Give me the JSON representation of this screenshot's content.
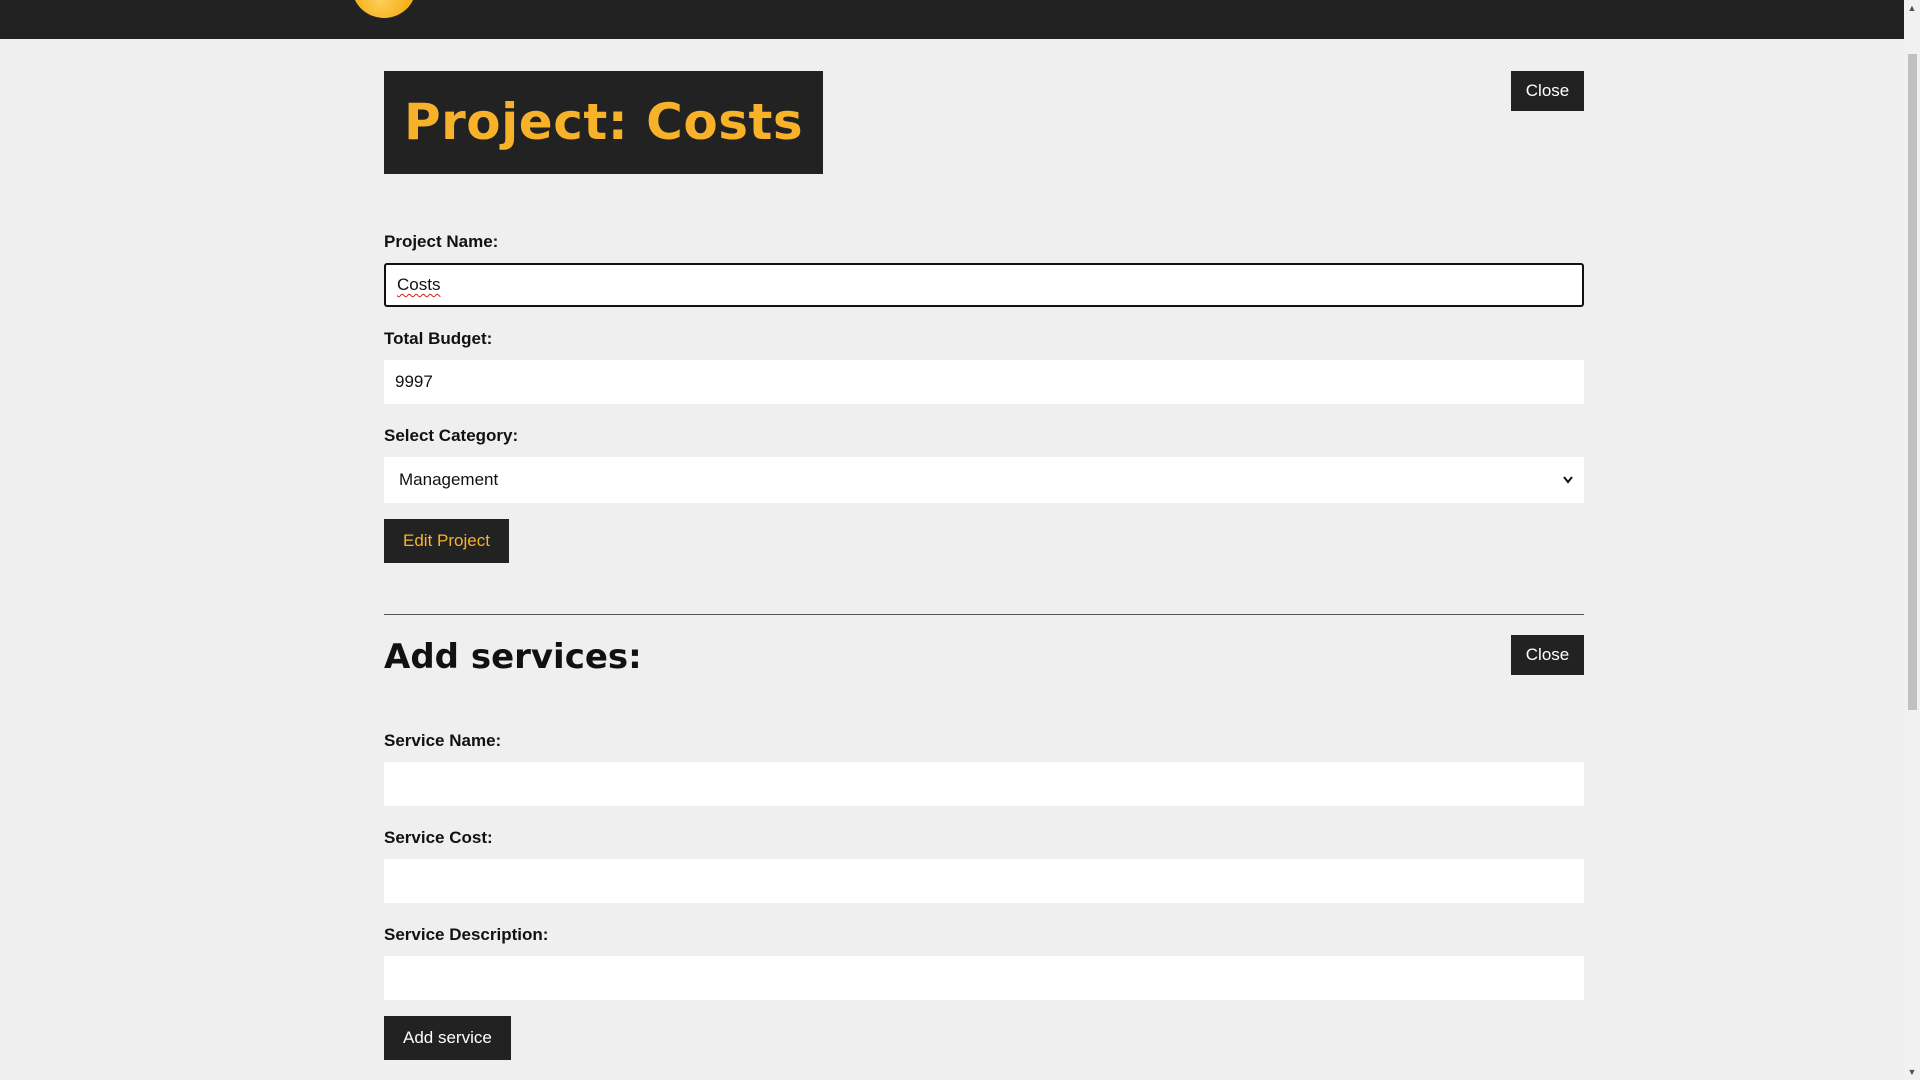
{
  "project": {
    "title": "Project: Costs",
    "close_label": "Close",
    "name_label": "Project Name:",
    "name_value": "Costs",
    "budget_label": "Total Budget:",
    "budget_value": "9997",
    "category_label": "Select Category:",
    "category_value": "Management",
    "edit_label": "Edit Project"
  },
  "services": {
    "title": "Add services:",
    "close_label": "Close",
    "name_label": "Service Name:",
    "name_value": "",
    "cost_label": "Service Cost:",
    "cost_value": "",
    "description_label": "Service Description:",
    "description_value": "",
    "add_label": "Add service"
  },
  "colors": {
    "accent": "#f7b22a",
    "dark": "#222222",
    "background": "#efefef"
  },
  "icons": {
    "logo": "sun-logo",
    "select": "chevron-down-icon"
  }
}
